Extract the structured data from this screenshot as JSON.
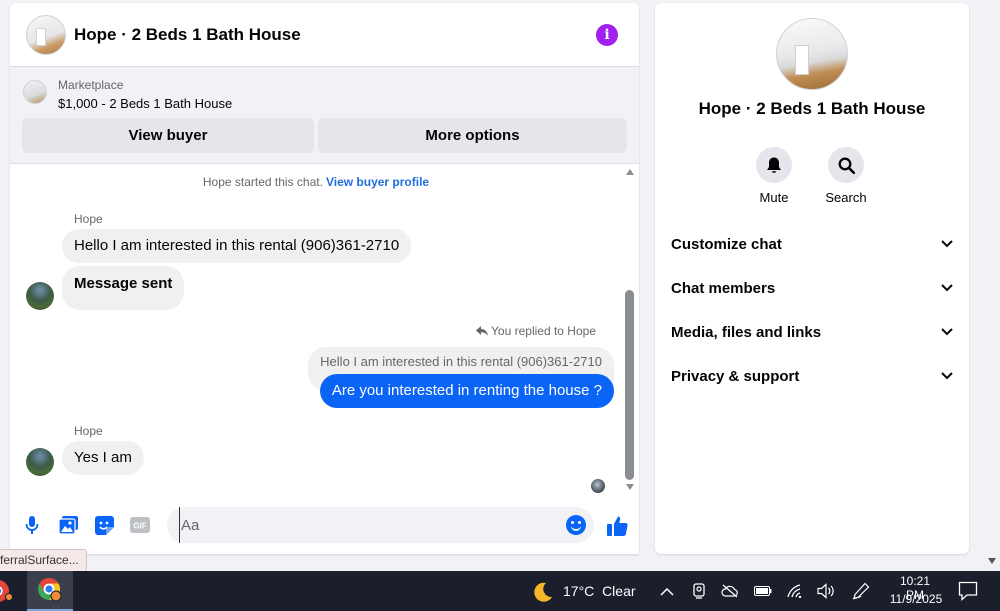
{
  "colors": {
    "accent_blue": "#0a64f6",
    "info_purple": "#a020f0",
    "link_blue": "#216fdb",
    "incoming_bubble": "#f0f0f0",
    "taskbar": "#1b1f2b"
  },
  "chat": {
    "header": {
      "title": "Hope · 2 Beds 1 Bath House",
      "info_icon": "info-icon"
    },
    "marketplace": {
      "label": "Marketplace",
      "listing": "$1,000 - 2 Beds 1 Bath House",
      "view_buyer_label": "View buyer",
      "more_options_label": "More options"
    },
    "system_note": {
      "text": "Hope started this chat.",
      "link": "View buyer profile"
    },
    "messages": [
      {
        "sender": "Hope",
        "text": "Hello I am interested in this rental (906)361-2710"
      },
      {
        "text": "Message sent"
      },
      {
        "reply_note": "You replied to Hope",
        "quoted": "Hello I am interested in this rental (906)361-2710",
        "text": "Are you interested in renting the house ?"
      },
      {
        "sender": "Hope",
        "text": "Yes I am"
      }
    ],
    "composer": {
      "placeholder": "Aa",
      "icons": [
        "microphone-icon",
        "photo-icon",
        "sticker-icon",
        "gif-icon",
        "emoji-icon",
        "thumbs-up-icon"
      ],
      "gif_label": "GIF"
    }
  },
  "info_panel": {
    "title": "Hope · 2 Beds 1 Bath House",
    "actions": [
      {
        "label": "Mute",
        "icon": "bell-icon"
      },
      {
        "label": "Search",
        "icon": "search-icon"
      }
    ],
    "sections": [
      "Customize chat",
      "Chat members",
      "Media, files and links",
      "Privacy & support"
    ]
  },
  "tooltip": {
    "text": "ferralSurface..."
  },
  "taskbar": {
    "weather": {
      "temp": "17°C",
      "condition": "Clear",
      "icon": "moon-icon"
    },
    "clock": {
      "time": "10:21 PM",
      "date": "11/9/2025"
    }
  }
}
